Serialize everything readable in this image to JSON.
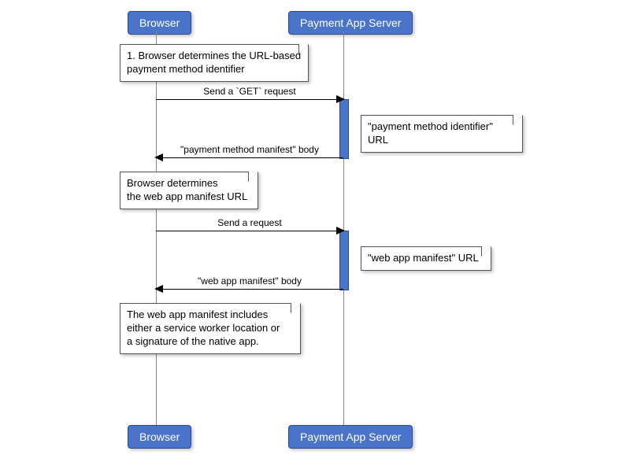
{
  "participants": {
    "browser_top": "Browser",
    "browser_bottom": "Browser",
    "server_top": "Payment App Server",
    "server_bottom": "Payment App Server"
  },
  "notes": {
    "n1_line1": "1. Browser determines the URL-based",
    "n1_line2": "payment method identifier",
    "n2_line1": "Browser determines",
    "n2_line2": "the web app manifest URL",
    "n3_line1": "The web app manifest includes",
    "n3_line2": "either a service worker location or",
    "n3_line3": "a signature of the native app.",
    "n_pmi": "\"payment method identifier\" URL",
    "n_wam": "\"web app manifest\" URL"
  },
  "messages": {
    "m1": "Send a `GET` request",
    "m2": "\"payment method manifest\" body",
    "m3": "Send a request",
    "m4": "\"web app manifest\" body"
  }
}
